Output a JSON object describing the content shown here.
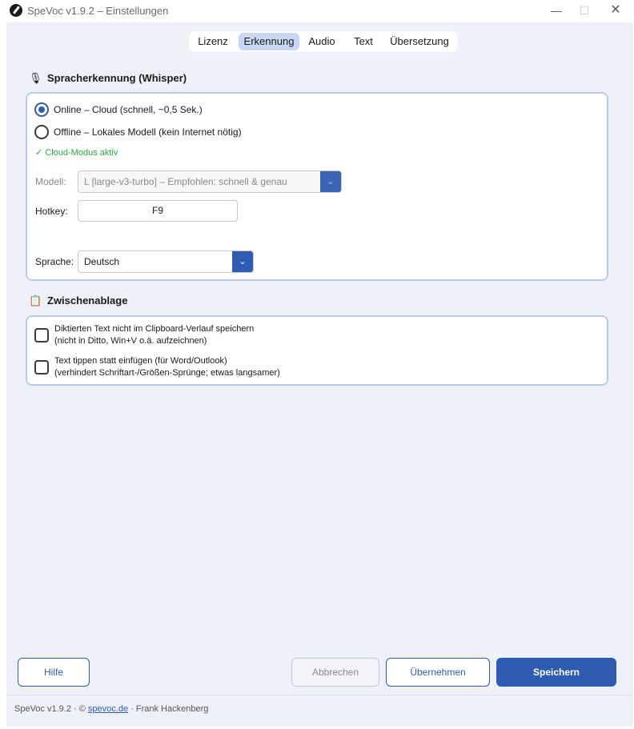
{
  "window": {
    "title": "SpeVoc v1.9.2 – Einstellungen",
    "controls": {
      "minimize": "—",
      "maximize": "☐",
      "close": "✕"
    }
  },
  "tabs": [
    "Lizenz",
    "Erkennung",
    "Audio",
    "Text",
    "Übersetzung"
  ],
  "active_tab": "Erkennung",
  "speech": {
    "title": "Spracherkennung (Whisper)",
    "icon": "microphone-icon",
    "online_label": "Online  –  Cloud (schnell, ~0,5 Sek.)",
    "offline_label": "Offline  –  Lokales Modell (kein Internet nötig)",
    "selected_mode": "online",
    "status": "✓ Cloud-Modus aktiv",
    "model_label": "Modell:",
    "model_value": "L  [large-v3-turbo]  – Empfohlen: schnell & genau",
    "hotkey_label": "Hotkey:",
    "hotkey_value": "F9",
    "language_label": "Sprache:",
    "language_value": "Deutsch"
  },
  "clipboard": {
    "title": "Zwischenablage",
    "icon": "clipboard-icon",
    "option1_line1": "Diktierten Text nicht im Clipboard-Verlauf speichern",
    "option1_line2": "(nicht in Ditto, Win+V o.ä. aufzeichnen)",
    "option2_line1": "Text tippen statt einfügen (für Word/Outlook)",
    "option2_line2": "(verhindert Schriftart-/Größen-Sprünge; etwas langsamer)",
    "option1_checked": false,
    "option2_checked": false
  },
  "buttons": {
    "help": "Hilfe",
    "cancel": "Abbrechen",
    "apply": "Übernehmen",
    "save": "Speichern"
  },
  "footer": {
    "version": "SpeVoc v1.9.2",
    "sep1": "·",
    "copyright": "©",
    "link": "spevoc.de",
    "sep2": "·",
    "author": "Frank Hackenberg"
  },
  "colors": {
    "accent": "#2f5bb0",
    "panel_bg": "#eef1f8",
    "card_border": "#b9cbeb",
    "active_tab": "#c9d7f1",
    "status_ok": "#28a745"
  }
}
